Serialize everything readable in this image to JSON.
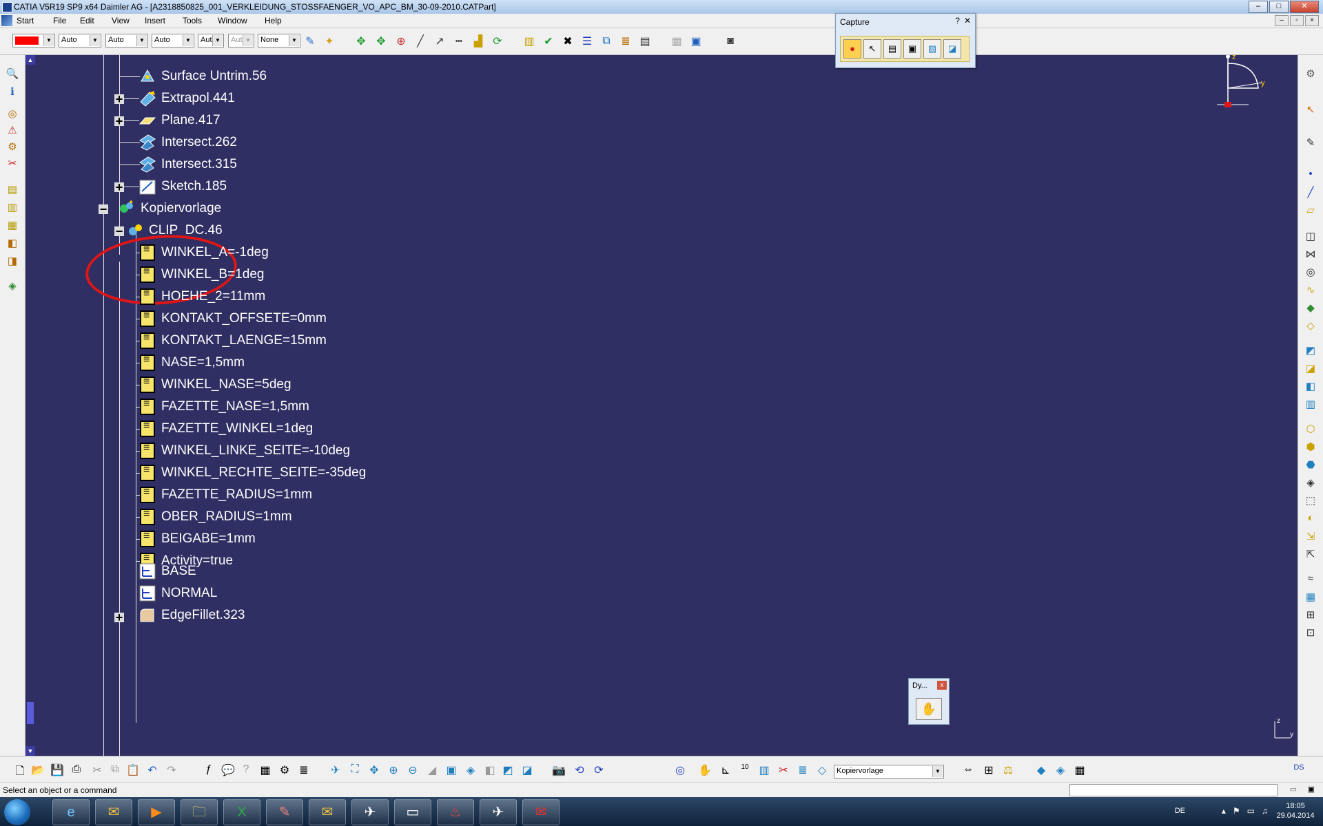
{
  "window": {
    "title": "CATIA V5R19 SP9 x64 Daimler AG - [A2318850825_001_VERKLEIDUNG_STOSSFAENGER_VO_APC_BM_30-09-2010.CATPart]",
    "min": "–",
    "max": "□",
    "close": "✕"
  },
  "menu": [
    "Start",
    "File",
    "Edit",
    "View",
    "Insert",
    "Tools",
    "Window",
    "Help"
  ],
  "toolbar": {
    "color_value": "",
    "transparency": "Auto",
    "linetype": "Auto",
    "thickness": "Auto",
    "point": "Aut",
    "layer_disabled": "Aut",
    "layer": "None"
  },
  "tree": {
    "top_items": [
      {
        "label": "Surface Untrim.56",
        "icon": "surface-untrim-icon",
        "expandable": false
      },
      {
        "label": "Extrapol.441",
        "icon": "extrapolate-icon",
        "expandable": true
      },
      {
        "label": "Plane.417",
        "icon": "plane-icon",
        "expandable": true
      },
      {
        "label": "Intersect.262",
        "icon": "intersect-icon",
        "expandable": false
      },
      {
        "label": "Intersect.315",
        "icon": "intersect-icon",
        "expandable": false
      },
      {
        "label": "Sketch.185",
        "icon": "sketch-icon",
        "expandable": true
      }
    ],
    "group": "Kopiervorlage",
    "selected": "CLIP_DC.46",
    "parameters": [
      "WINKEL_A=-1deg",
      "WINKEL_B=1deg",
      "HOEHE_2=11mm",
      "KONTAKT_OFFSETE=0mm",
      "KONTAKT_LAENGE=15mm",
      "NASE=1,5mm",
      "WINKEL_NASE=5deg",
      "FAZETTE_NASE=1,5mm",
      "FAZETTE_WINKEL=1deg",
      "WINKEL_LINKE_SEITE=-10deg",
      "WINKEL_RECHTE_SEITE=-35deg",
      "FAZETTE_RADIUS=1mm",
      "OBER_RADIUS=1mm",
      "BEIGABE=1mm",
      "Activity=true"
    ],
    "axes": [
      "BASE",
      "NORMAL"
    ],
    "last": "EdgeFillet.323"
  },
  "capture": {
    "title": "Capture",
    "help": "?",
    "close": "✕"
  },
  "dyn": {
    "title": "Dy...",
    "close": "x"
  },
  "compass": {
    "z": "z",
    "y": "y"
  },
  "mini_axes": {
    "z": "z",
    "y": "y"
  },
  "bottom_toolbar": {
    "current_tool": "Kopiervorlage"
  },
  "status": {
    "text": "Select an object or a command"
  },
  "taskbar": {
    "lang": "DE",
    "time": "18:05",
    "date": "29.04.2014"
  },
  "colors": {
    "viewport": "#2f2f63",
    "accent_red": "#e01616",
    "param_icon": "#f6e46b"
  }
}
